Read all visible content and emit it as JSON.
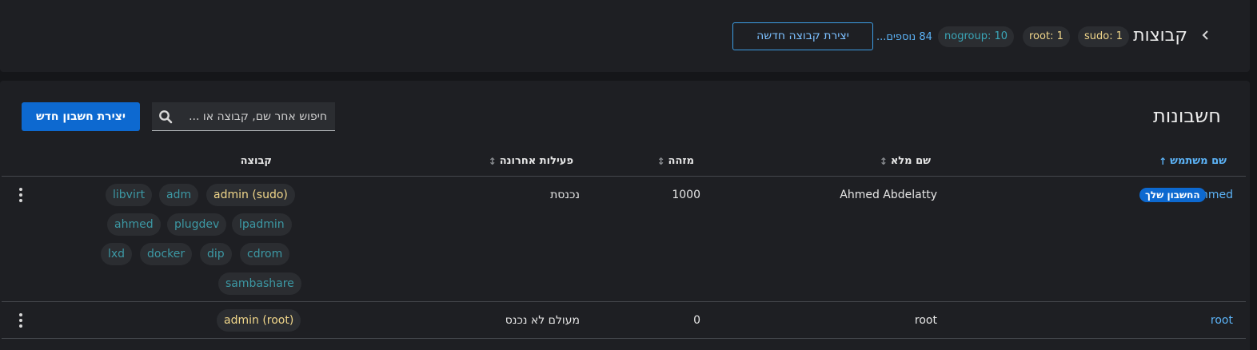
{
  "groups": {
    "title": "קבוצות",
    "chips": [
      {
        "label": "sudo: 1"
      },
      {
        "label": "root: 1"
      },
      {
        "label": "nogroup: 10"
      }
    ],
    "more_link": "84 נוספים...",
    "create_button": "יצירת קבוצה חדשה"
  },
  "accounts": {
    "title": "חשבונות",
    "search_placeholder": "חיפוש אחר שם, קבוצה או ...",
    "create_button": "יצירת חשבון חדש",
    "columns": {
      "username": "שם משתמש",
      "full_name": "שם מלא",
      "id": "מזהה",
      "last_active": "פעילות אחרונה",
      "group": "קבוצה"
    },
    "sort_icons": {
      "active": "↑",
      "inactive": "↕"
    },
    "rows": [
      {
        "username": "ahmed",
        "you_badge": "החשבון שלך",
        "full_name": "Ahmed Abdelatty",
        "id": "1000",
        "last_active": "נכנסת",
        "groups": [
          "admin (sudo)",
          "adm",
          "libvirt",
          "lpadmin",
          "plugdev",
          "ahmed",
          "cdrom",
          "dip",
          "docker",
          "lxd",
          "sambashare"
        ]
      },
      {
        "username": "root",
        "full_name": "root",
        "id": "0",
        "last_active": "מעולם לא נכנס",
        "groups": [
          "admin (root)"
        ]
      }
    ]
  }
}
